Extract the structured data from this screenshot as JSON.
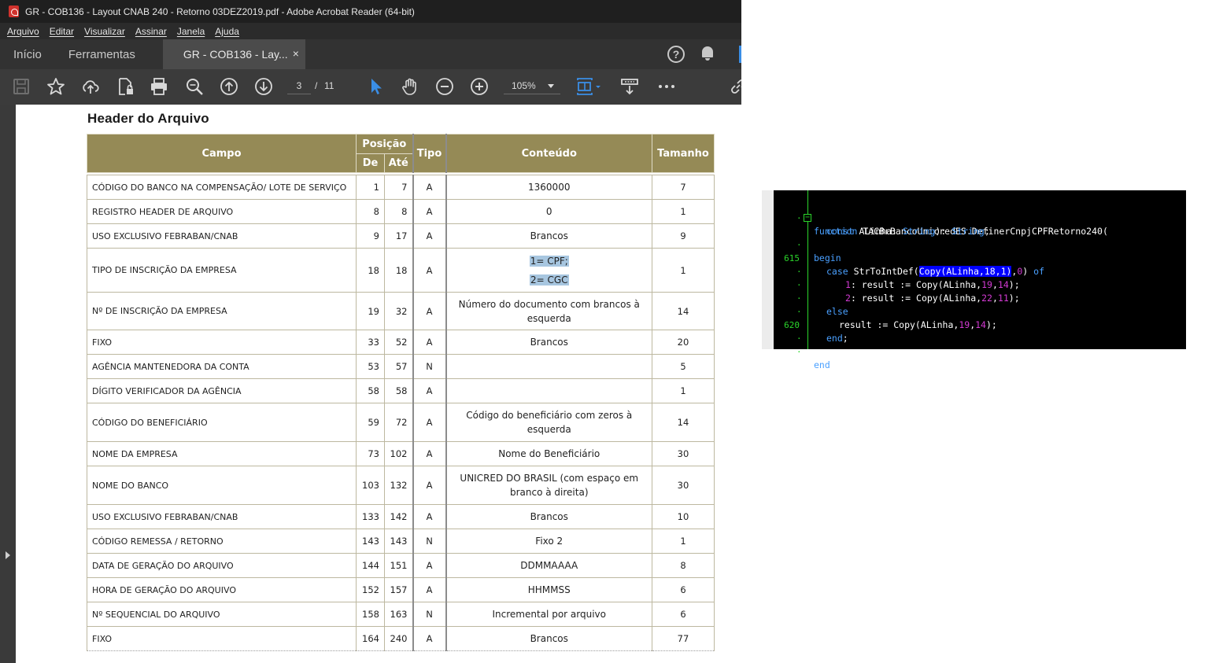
{
  "window": {
    "title": "GR - COB136 - Layout CNAB 240 - Retorno 03DEZ2019.pdf - Adobe Acrobat Reader (64-bit)"
  },
  "menu": [
    "Arquivo",
    "Editar",
    "Visualizar",
    "Assinar",
    "Janela",
    "Ajuda"
  ],
  "tabs": {
    "home": "Início",
    "tools": "Ferramentas",
    "document": "GR - COB136 - Lay...",
    "close": "×"
  },
  "toolbar": {
    "current_page": "3",
    "separator": "/",
    "total_pages": "11",
    "zoom": "105%",
    "accent": "#3a8ee6"
  },
  "document": {
    "section_title": "Header do Arquivo",
    "header": {
      "campo": "Campo",
      "posicao": "Posição",
      "de": "De",
      "ate": "Até",
      "tipo": "Tipo",
      "conteudo": "Conteúdo",
      "tamanho": "Tamanho",
      "color": "#958a56"
    },
    "rows": [
      {
        "campo": "CÓDIGO DO BANCO NA COMPENSAÇÃO/ LOTE DE SERVIÇO",
        "de": "1",
        "ate": "7",
        "tipo": "A",
        "conteudo": "1360000",
        "tamanho": "7"
      },
      {
        "campo": "REGISTRO HEADER DE ARQUIVO",
        "de": "8",
        "ate": "8",
        "tipo": "A",
        "conteudo": "0",
        "tamanho": "1"
      },
      {
        "campo": "USO EXCLUSIVO FEBRABAN/CNAB",
        "de": "9",
        "ate": "17",
        "tipo": "A",
        "conteudo": "Brancos",
        "tamanho": "9"
      },
      {
        "campo": "TIPO DE INSCRIÇÃO DA EMPRESA",
        "de": "18",
        "ate": "18",
        "tipo": "A",
        "conteudo_line1": "1= CPF;",
        "conteudo_line2": "2= CGC",
        "tamanho": "1"
      },
      {
        "campo": "Nº DE INSCRIÇÃO DA EMPRESA",
        "de": "19",
        "ate": "32",
        "tipo": "A",
        "conteudo_line1": "Número do documento com brancos à",
        "conteudo_line2": "esquerda",
        "tamanho": "14"
      },
      {
        "campo": "FIXO",
        "de": "33",
        "ate": "52",
        "tipo": "A",
        "conteudo": "Brancos",
        "tamanho": "20"
      },
      {
        "campo": "AGÊNCIA MANTENEDORA DA CONTA",
        "de": "53",
        "ate": "57",
        "tipo": "N",
        "conteudo": "",
        "tamanho": "5"
      },
      {
        "campo": "DÍGITO VERIFICADOR DA AGÊNCIA",
        "de": "58",
        "ate": "58",
        "tipo": "A",
        "conteudo": "",
        "tamanho": "1"
      },
      {
        "campo": "CÓDIGO DO BENEFICIÁRIO",
        "de": "59",
        "ate": "72",
        "tipo": "A",
        "conteudo_line1": "Código do beneficiário com zeros à",
        "conteudo_line2": "esquerda",
        "tamanho": "14"
      },
      {
        "campo": "NOME DA EMPRESA",
        "de": "73",
        "ate": "102",
        "tipo": "A",
        "conteudo": "Nome do Beneficiário",
        "tamanho": "30"
      },
      {
        "campo": "NOME DO BANCO",
        "de": "103",
        "ate": "132",
        "tipo": "A",
        "conteudo_line1": "UNICRED DO BRASIL (com espaço em",
        "conteudo_line2": "branco à direita)",
        "tamanho": "30"
      },
      {
        "campo": "USO EXCLUSIVO FEBRABAN/CNAB",
        "de": "133",
        "ate": "142",
        "tipo": "A",
        "conteudo": "Brancos",
        "tamanho": "10"
      },
      {
        "campo": "CÓDIGO REMESSA / RETORNO",
        "de": "143",
        "ate": "143",
        "tipo": "N",
        "conteudo": "Fixo 2",
        "tamanho": "1"
      },
      {
        "campo": "DATA DE GERAÇÃO DO ARQUIVO",
        "de": "144",
        "ate": "151",
        "tipo": "A",
        "conteudo": "DDMMAAAA",
        "tamanho": "8"
      },
      {
        "campo": "HORA DE GERAÇÃO DO ARQUIVO",
        "de": "152",
        "ate": "157",
        "tipo": "A",
        "conteudo": "HHMMSS",
        "tamanho": "6"
      },
      {
        "campo": "Nº SEQUENCIAL DO ARQUIVO",
        "de": "158",
        "ate": "163",
        "tipo": "N",
        "conteudo": "Incremental por arquivo",
        "tamanho": "6"
      },
      {
        "campo": "FIXO",
        "de": "164",
        "ate": "240",
        "tipo": "A",
        "conteudo": "Brancos",
        "tamanho": "77"
      }
    ]
  },
  "code": {
    "line_numbers": {
      "l615": "615",
      "l620": "620"
    },
    "l1": {
      "kw": "function",
      "rest": " TACBrBancoUnicredES.DefinerCnpjCPFRetorno240("
    },
    "l2": {
      "kw": "const",
      "name": " ALinha: ",
      "type1": "String",
      "mid": "): ",
      "type2": "String",
      "end": ";"
    },
    "l3": {
      "kw": "begin"
    },
    "l4": {
      "kw": "case",
      "pre": " StrToIntDef(",
      "hl": "Copy(ALinha,18,1)",
      "comma": ",",
      "num": "0",
      "close": ") ",
      "kw2": "of"
    },
    "l5": {
      "n": "1",
      "pre": ": result := Copy(ALinha,",
      "a": "19",
      "c": ",",
      "b": "14",
      "end": ");"
    },
    "l6": {
      "n": "2",
      "pre": ": result := Copy(ALinha,",
      "a": "22",
      "c": ",",
      "b": "11",
      "end": ");"
    },
    "l7": {
      "kw": "else"
    },
    "l8": {
      "pre": "result := Copy(ALinha,",
      "a": "19",
      "c": ",",
      "b": "14",
      "end": ");"
    },
    "l9": {
      "kw": "end",
      "end": ";"
    },
    "l11": {
      "kw": "end",
      "end": ";"
    },
    "colors": {
      "keyword": "#4aa0ff",
      "number": "#d23ad2",
      "gutter": "#2bd62b",
      "highlight": "#0000ff"
    }
  }
}
